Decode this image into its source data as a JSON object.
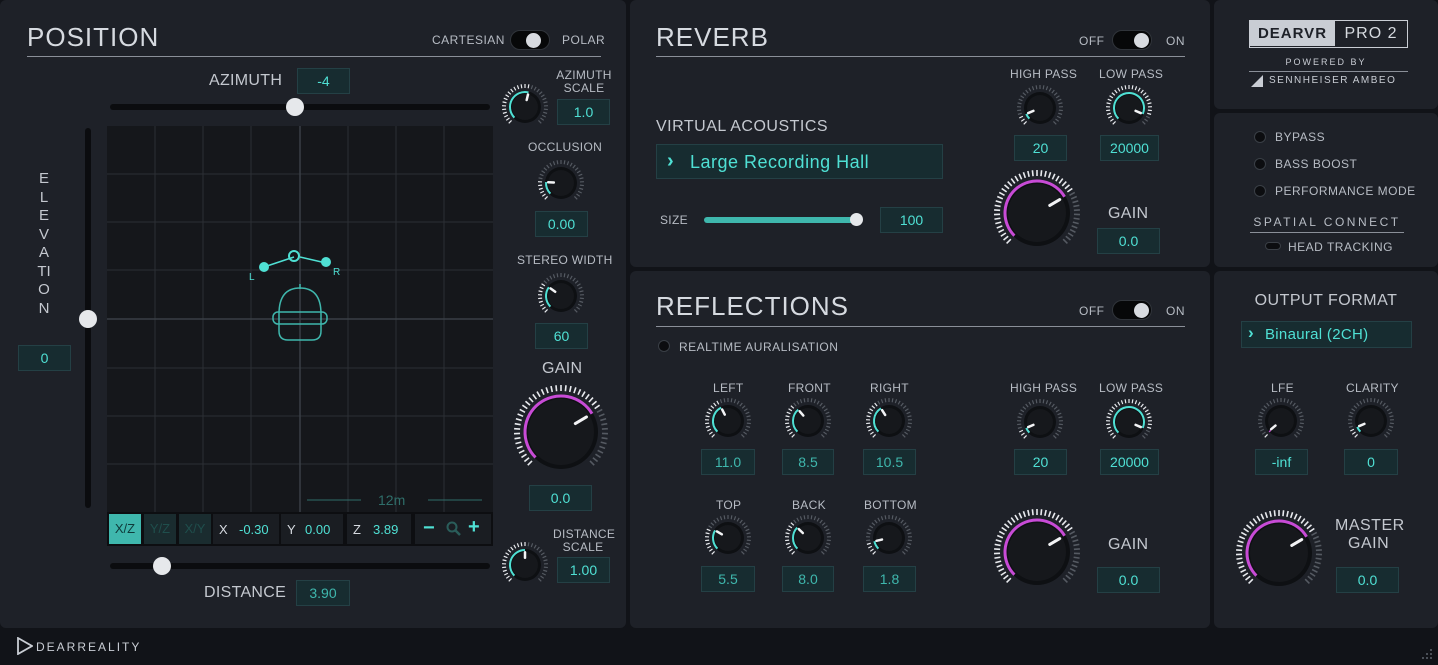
{
  "position": {
    "title": "POSITION",
    "cartesian_label": "CARTESIAN",
    "polar_label": "POLAR",
    "azimuth_label": "AZIMUTH",
    "azimuth_value": "-4",
    "azimuth_scale_label": "AZIMUTH SCALE",
    "azimuth_scale_value": "1.0",
    "occlusion_label": "OCCLUSION",
    "occlusion_value": "0.00",
    "stereo_width_label": "STEREO WIDTH",
    "stereo_width_value": "60",
    "gain_label": "GAIN",
    "gain_value": "0.0",
    "distance_scale_label": "DISTANCE SCALE",
    "distance_scale_value": "1.00",
    "distance_label": "DISTANCE",
    "distance_value": "3.90",
    "elevation_label": "ELEVATION",
    "elevation_value": "0",
    "grid_scale_label": "12m",
    "left_marker": "L",
    "right_marker": "R",
    "views": [
      "X/Z",
      "Y/Z",
      "X/Y"
    ],
    "x_label": "X",
    "x_value": "-0.30",
    "y_label": "Y",
    "y_value": "0.00",
    "z_label": "Z",
    "z_value": "3.89",
    "zoom_out": "−",
    "zoom_in": "+"
  },
  "reverb": {
    "title": "REVERB",
    "off_label": "OFF",
    "on_label": "ON",
    "virtual_acoustics_label": "VIRTUAL ACOUSTICS",
    "preset": "Large Recording Hall",
    "size_label": "SIZE",
    "size_value": "100",
    "high_pass_label": "HIGH PASS",
    "high_pass_value": "20",
    "low_pass_label": "LOW PASS",
    "low_pass_value": "20000",
    "gain_label": "GAIN",
    "gain_value": "0.0"
  },
  "reflections": {
    "title": "REFLECTIONS",
    "off_label": "OFF",
    "on_label": "ON",
    "realtime_label": "REALTIME AURALISATION",
    "left_label": "LEFT",
    "left_value": "11.0",
    "front_label": "FRONT",
    "front_value": "8.5",
    "right_label": "RIGHT",
    "right_value": "10.5",
    "top_label": "TOP",
    "top_value": "5.5",
    "back_label": "BACK",
    "back_value": "8.0",
    "bottom_label": "BOTTOM",
    "bottom_value": "1.8",
    "high_pass_label": "HIGH PASS",
    "high_pass_value": "20",
    "low_pass_label": "LOW PASS",
    "low_pass_value": "20000",
    "gain_label": "GAIN",
    "gain_value": "0.0"
  },
  "brand": {
    "logo_dear": "DEARVR",
    "logo_pro": "PRO 2",
    "powered_by": "POWERED BY",
    "sennheiser": "SENNHEISER AMBEO",
    "footer": "DEARREALITY"
  },
  "options": {
    "bypass": "BYPASS",
    "bass_boost": "BASS BOOST",
    "performance_mode": "PERFORMANCE MODE",
    "spatial_connect": "SPATIAL CONNECT",
    "head_tracking": "HEAD TRACKING"
  },
  "output": {
    "title": "OUTPUT FORMAT",
    "format": "Binaural (2CH)",
    "lfe_label": "LFE",
    "lfe_value": "-inf",
    "clarity_label": "CLARITY",
    "clarity_value": "0",
    "master_gain_label_1": "MASTER",
    "master_gain_label_2": "GAIN",
    "master_gain_value": "0.0"
  },
  "colors": {
    "accent": "#4fe0d4",
    "magenta": "#c84bd6",
    "panel": "#1e2128"
  }
}
